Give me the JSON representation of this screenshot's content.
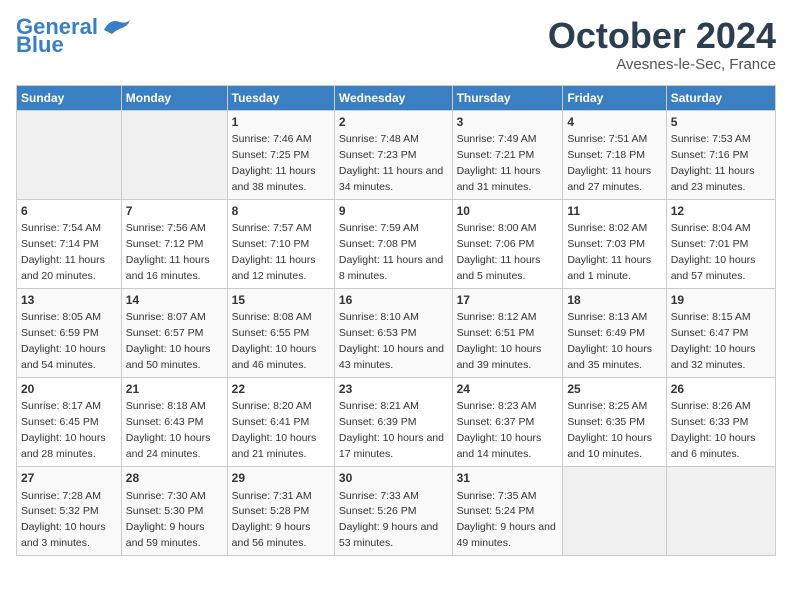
{
  "header": {
    "logo_line1": "General",
    "logo_line2": "Blue",
    "month_title": "October 2024",
    "location": "Avesnes-le-Sec, France"
  },
  "weekdays": [
    "Sunday",
    "Monday",
    "Tuesday",
    "Wednesday",
    "Thursday",
    "Friday",
    "Saturday"
  ],
  "weeks": [
    [
      {
        "day": "",
        "info": ""
      },
      {
        "day": "",
        "info": ""
      },
      {
        "day": "1",
        "info": "Sunrise: 7:46 AM\nSunset: 7:25 PM\nDaylight: 11 hours and 38 minutes."
      },
      {
        "day": "2",
        "info": "Sunrise: 7:48 AM\nSunset: 7:23 PM\nDaylight: 11 hours and 34 minutes."
      },
      {
        "day": "3",
        "info": "Sunrise: 7:49 AM\nSunset: 7:21 PM\nDaylight: 11 hours and 31 minutes."
      },
      {
        "day": "4",
        "info": "Sunrise: 7:51 AM\nSunset: 7:18 PM\nDaylight: 11 hours and 27 minutes."
      },
      {
        "day": "5",
        "info": "Sunrise: 7:53 AM\nSunset: 7:16 PM\nDaylight: 11 hours and 23 minutes."
      }
    ],
    [
      {
        "day": "6",
        "info": "Sunrise: 7:54 AM\nSunset: 7:14 PM\nDaylight: 11 hours and 20 minutes."
      },
      {
        "day": "7",
        "info": "Sunrise: 7:56 AM\nSunset: 7:12 PM\nDaylight: 11 hours and 16 minutes."
      },
      {
        "day": "8",
        "info": "Sunrise: 7:57 AM\nSunset: 7:10 PM\nDaylight: 11 hours and 12 minutes."
      },
      {
        "day": "9",
        "info": "Sunrise: 7:59 AM\nSunset: 7:08 PM\nDaylight: 11 hours and 8 minutes."
      },
      {
        "day": "10",
        "info": "Sunrise: 8:00 AM\nSunset: 7:06 PM\nDaylight: 11 hours and 5 minutes."
      },
      {
        "day": "11",
        "info": "Sunrise: 8:02 AM\nSunset: 7:03 PM\nDaylight: 11 hours and 1 minute."
      },
      {
        "day": "12",
        "info": "Sunrise: 8:04 AM\nSunset: 7:01 PM\nDaylight: 10 hours and 57 minutes."
      }
    ],
    [
      {
        "day": "13",
        "info": "Sunrise: 8:05 AM\nSunset: 6:59 PM\nDaylight: 10 hours and 54 minutes."
      },
      {
        "day": "14",
        "info": "Sunrise: 8:07 AM\nSunset: 6:57 PM\nDaylight: 10 hours and 50 minutes."
      },
      {
        "day": "15",
        "info": "Sunrise: 8:08 AM\nSunset: 6:55 PM\nDaylight: 10 hours and 46 minutes."
      },
      {
        "day": "16",
        "info": "Sunrise: 8:10 AM\nSunset: 6:53 PM\nDaylight: 10 hours and 43 minutes."
      },
      {
        "day": "17",
        "info": "Sunrise: 8:12 AM\nSunset: 6:51 PM\nDaylight: 10 hours and 39 minutes."
      },
      {
        "day": "18",
        "info": "Sunrise: 8:13 AM\nSunset: 6:49 PM\nDaylight: 10 hours and 35 minutes."
      },
      {
        "day": "19",
        "info": "Sunrise: 8:15 AM\nSunset: 6:47 PM\nDaylight: 10 hours and 32 minutes."
      }
    ],
    [
      {
        "day": "20",
        "info": "Sunrise: 8:17 AM\nSunset: 6:45 PM\nDaylight: 10 hours and 28 minutes."
      },
      {
        "day": "21",
        "info": "Sunrise: 8:18 AM\nSunset: 6:43 PM\nDaylight: 10 hours and 24 minutes."
      },
      {
        "day": "22",
        "info": "Sunrise: 8:20 AM\nSunset: 6:41 PM\nDaylight: 10 hours and 21 minutes."
      },
      {
        "day": "23",
        "info": "Sunrise: 8:21 AM\nSunset: 6:39 PM\nDaylight: 10 hours and 17 minutes."
      },
      {
        "day": "24",
        "info": "Sunrise: 8:23 AM\nSunset: 6:37 PM\nDaylight: 10 hours and 14 minutes."
      },
      {
        "day": "25",
        "info": "Sunrise: 8:25 AM\nSunset: 6:35 PM\nDaylight: 10 hours and 10 minutes."
      },
      {
        "day": "26",
        "info": "Sunrise: 8:26 AM\nSunset: 6:33 PM\nDaylight: 10 hours and 6 minutes."
      }
    ],
    [
      {
        "day": "27",
        "info": "Sunrise: 7:28 AM\nSunset: 5:32 PM\nDaylight: 10 hours and 3 minutes."
      },
      {
        "day": "28",
        "info": "Sunrise: 7:30 AM\nSunset: 5:30 PM\nDaylight: 9 hours and 59 minutes."
      },
      {
        "day": "29",
        "info": "Sunrise: 7:31 AM\nSunset: 5:28 PM\nDaylight: 9 hours and 56 minutes."
      },
      {
        "day": "30",
        "info": "Sunrise: 7:33 AM\nSunset: 5:26 PM\nDaylight: 9 hours and 53 minutes."
      },
      {
        "day": "31",
        "info": "Sunrise: 7:35 AM\nSunset: 5:24 PM\nDaylight: 9 hours and 49 minutes."
      },
      {
        "day": "",
        "info": ""
      },
      {
        "day": "",
        "info": ""
      }
    ]
  ]
}
